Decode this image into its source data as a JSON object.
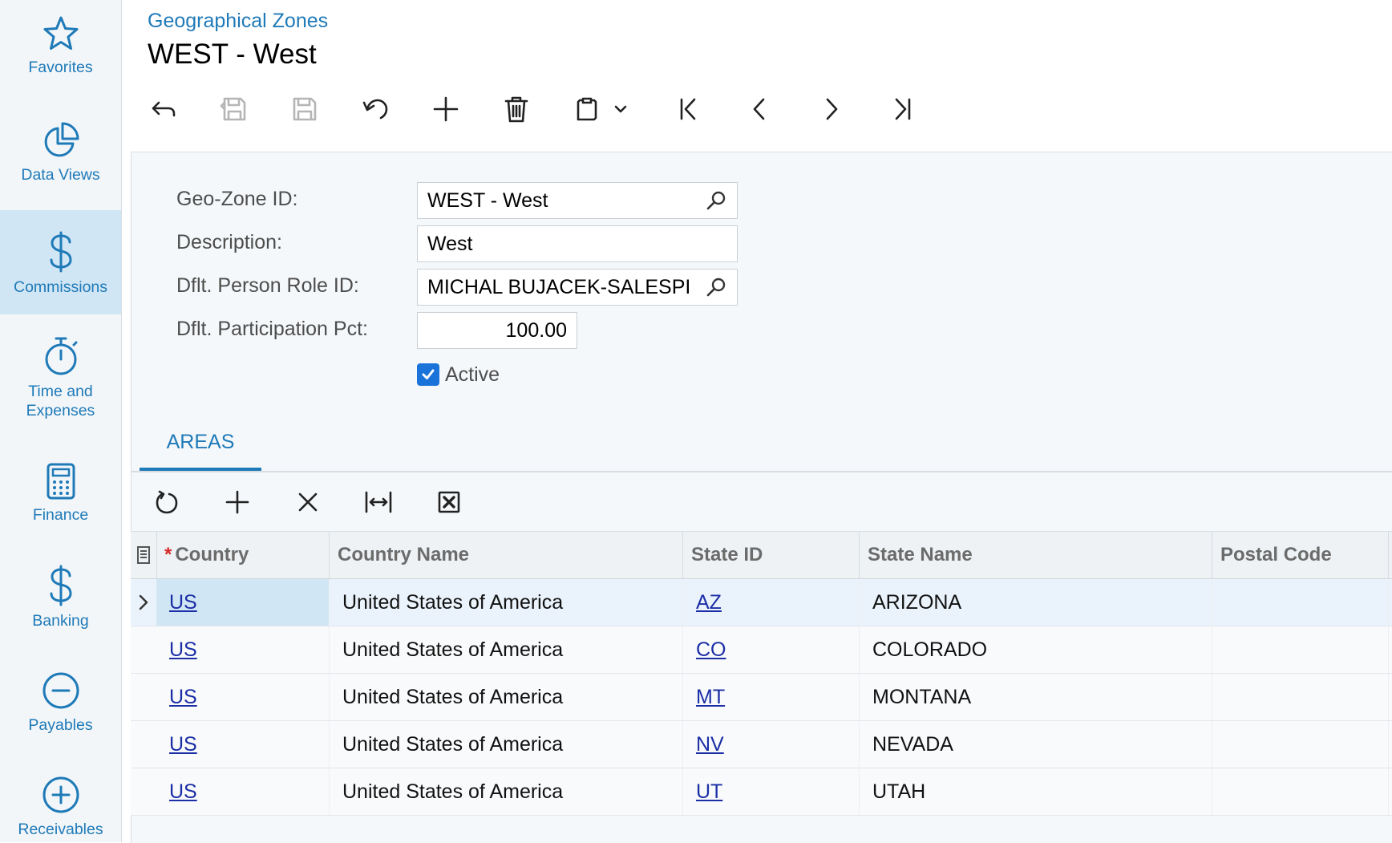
{
  "sidebar": {
    "items": [
      {
        "label": "Favorites",
        "icon": "star-icon"
      },
      {
        "label": "Data Views",
        "icon": "pie-chart-icon"
      },
      {
        "label": "Commissions",
        "icon": "dollar-icon",
        "active": true
      },
      {
        "label_line1": "Time and",
        "label_line2": "Expenses",
        "icon": "stopwatch-icon"
      },
      {
        "label": "Finance",
        "icon": "calculator-icon"
      },
      {
        "label": "Banking",
        "icon": "dollar-icon"
      },
      {
        "label": "Payables",
        "icon": "minus-circle-icon"
      },
      {
        "label": "Receivables",
        "icon": "plus-circle-icon"
      }
    ]
  },
  "header": {
    "screen_title": "Geographical Zones",
    "record_title": "WEST - West"
  },
  "toolbar": {
    "buttons": [
      "undo-arrow-icon",
      "save-close-icon",
      "save-icon",
      "cancel-icon",
      "add-icon",
      "delete-icon",
      "clipboard-icon",
      "chevron-down-icon",
      "first-record-icon",
      "previous-record-icon",
      "next-record-icon",
      "last-record-icon"
    ]
  },
  "form": {
    "geo_zone_label": "Geo-Zone ID:",
    "geo_zone_value": "WEST - West",
    "description_label": "Description:",
    "description_value": "West",
    "person_role_label": "Dflt. Person Role ID:",
    "person_role_value": "MICHAL BUJACEK-SALESPI",
    "participation_label": "Dflt. Participation Pct:",
    "participation_value": "100.00",
    "active_label": "Active",
    "active_checked": true
  },
  "tabs": {
    "areas": "AREAS"
  },
  "grid": {
    "columns": {
      "country": "Country",
      "country_name": "Country Name",
      "state_id": "State ID",
      "state_name": "State Name",
      "postal_code": "Postal Code"
    },
    "rows": [
      {
        "country": "US",
        "country_name": "United States of America",
        "state_id": "AZ",
        "state_name": "ARIZONA",
        "postal_code": ""
      },
      {
        "country": "US",
        "country_name": "United States of America",
        "state_id": "CO",
        "state_name": "COLORADO",
        "postal_code": ""
      },
      {
        "country": "US",
        "country_name": "United States of America",
        "state_id": "MT",
        "state_name": "MONTANA",
        "postal_code": ""
      },
      {
        "country": "US",
        "country_name": "United States of America",
        "state_id": "NV",
        "state_name": "NEVADA",
        "postal_code": ""
      },
      {
        "country": "US",
        "country_name": "United States of America",
        "state_id": "UT",
        "state_name": "UTAH",
        "postal_code": ""
      }
    ]
  },
  "colors": {
    "accent": "#1f7ab8",
    "link": "#1b2ea6",
    "checkbox": "#1a73d9",
    "required": "#d62828"
  }
}
